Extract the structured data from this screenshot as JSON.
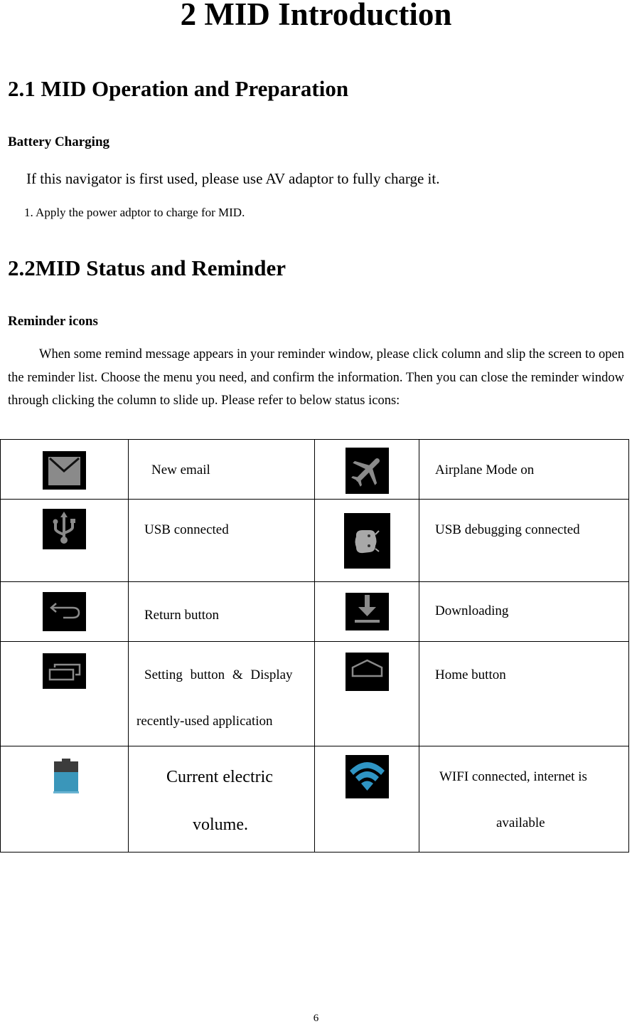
{
  "chapter_title": "2 MID Introduction",
  "section_1": {
    "title": "2.1 MID Operation and Preparation",
    "subheading": "Battery Charging",
    "intro": "If this navigator is first used, please use AV adaptor to fully charge it.",
    "steps": [
      "1. Apply the power adptor to charge for MID."
    ]
  },
  "section_2": {
    "title": "2.2MID Status and Reminder",
    "subheading": "Reminder icons",
    "paragraph": "When some remind message appears in your reminder window, please click column and slip the screen to open the reminder list. Choose the menu you need, and confirm the information. Then you can close the reminder window through clicking the column to slide up. Please refer to below status icons:"
  },
  "icon_table": {
    "rows": [
      [
        {
          "icon": "email-icon",
          "label": "New email"
        },
        {
          "icon": "airplane-mode-icon",
          "label": "Airplane Mode on"
        }
      ],
      [
        {
          "icon": "usb-icon",
          "label": "USB connected"
        },
        {
          "icon": "usb-debugging-icon",
          "label": "USB debugging connected"
        }
      ],
      [
        {
          "icon": "return-icon",
          "label": "Return button"
        },
        {
          "icon": "download-icon",
          "label": "Downloading"
        }
      ],
      [
        {
          "icon": "recent-apps-icon",
          "label_line1": "Setting button & Display",
          "label_line2": "recently-used application"
        },
        {
          "icon": "home-icon",
          "label": "Home button"
        }
      ],
      [
        {
          "icon": "battery-icon",
          "label_line1": "Current electric",
          "label_line2": "volume.",
          "battery_level_percent": 60
        },
        {
          "icon": "wifi-icon",
          "label_line1": "WIFI connected, internet is",
          "label_line2": "available"
        }
      ]
    ]
  },
  "colors": {
    "icon_background": "#000000",
    "icon_gray": "#8a8a8a",
    "battery_fill": "#3a96ba",
    "battery_empty": "#3c3c3c",
    "wifi_blue": "#2f95c4"
  },
  "page_number": "6"
}
